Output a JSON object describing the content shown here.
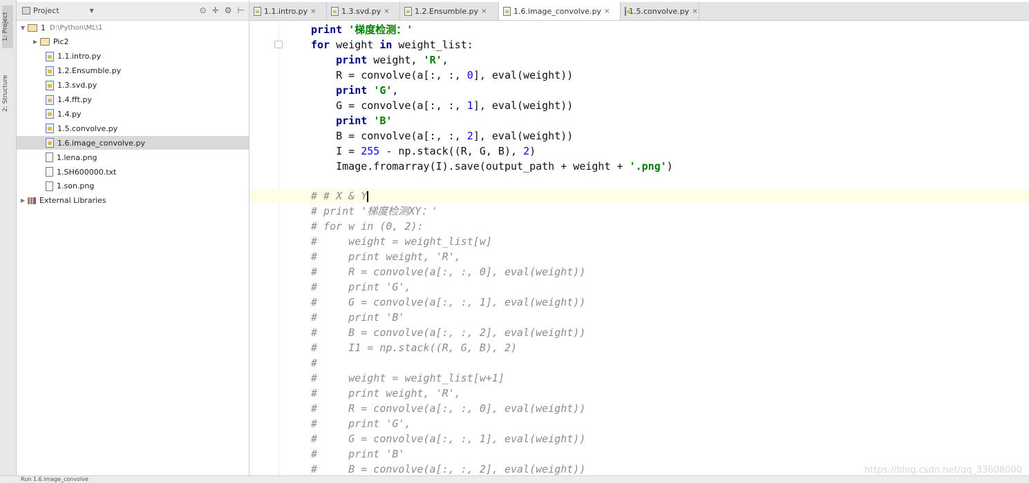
{
  "left_strip": {
    "tab1": "1: Project",
    "tab2": "2: Structure"
  },
  "project_panel": {
    "title": "Project",
    "tree": [
      {
        "label": "1",
        "path": "D:\\Python\\ML\\1",
        "type": "folder",
        "expanded": true,
        "depth": 0
      },
      {
        "label": "Pic2",
        "type": "folder",
        "expanded": false,
        "depth": 1
      },
      {
        "label": "1.1.intro.py",
        "type": "py",
        "depth": 2
      },
      {
        "label": "1.2.Ensumble.py",
        "type": "py",
        "depth": 2
      },
      {
        "label": "1.3.svd.py",
        "type": "py",
        "depth": 2
      },
      {
        "label": "1.4.fft.py",
        "type": "py",
        "depth": 2
      },
      {
        "label": "1.4.py",
        "type": "py",
        "depth": 2
      },
      {
        "label": "1.5.convolve.py",
        "type": "py",
        "depth": 2
      },
      {
        "label": "1.6.image_convolve.py",
        "type": "py",
        "depth": 2,
        "selected": true
      },
      {
        "label": "1.lena.png",
        "type": "img",
        "depth": 2
      },
      {
        "label": "1.SH600000.txt",
        "type": "txt",
        "depth": 2
      },
      {
        "label": "1.son.png",
        "type": "img",
        "depth": 2
      },
      {
        "label": "External Libraries",
        "type": "lib",
        "expanded": false,
        "depth": 0
      }
    ]
  },
  "tabs": [
    {
      "label": "1.1.intro.py",
      "active": false
    },
    {
      "label": "1.3.svd.py",
      "active": false
    },
    {
      "label": "1.2.Ensumble.py",
      "active": false
    },
    {
      "label": "1.6.image_convolve.py",
      "active": true
    },
    {
      "label": "1.5.convolve.py",
      "active": false
    }
  ],
  "close_glyph": "×",
  "code": {
    "lines": [
      "print '梯度检测：'",
      "for weight in weight_list:",
      "    print weight, 'R',",
      "    R = convolve(a[:, :, 0], eval(weight))",
      "    print 'G',",
      "    G = convolve(a[:, :, 1], eval(weight))",
      "    print 'B'",
      "    B = convolve(a[:, :, 2], eval(weight))",
      "    I = 255 - np.stack((R, G, B), 2)",
      "    Image.fromarray(I).save(output_path + weight + '.png')",
      "",
      "# # X & Y",
      "# print '梯度检测XY：'",
      "# for w in (0, 2):",
      "#     weight = weight_list[w]",
      "#     print weight, 'R',",
      "#     R = convolve(a[:, :, 0], eval(weight))",
      "#     print 'G',",
      "#     G = convolve(a[:, :, 1], eval(weight))",
      "#     print 'B'",
      "#     B = convolve(a[:, :, 2], eval(weight))",
      "#     I1 = np.stack((R, G, B), 2)",
      "#",
      "#     weight = weight_list[w+1]",
      "#     print weight, 'R',",
      "#     R = convolve(a[:, :, 0], eval(weight))",
      "#     print 'G',",
      "#     G = convolve(a[:, :, 1], eval(weight))",
      "#     print 'B'",
      "#     B = convolve(a[:, :, 2], eval(weight))"
    ],
    "current_line": 11
  },
  "bottom_bar": {
    "label": "Run  1.6.image_convolve"
  },
  "watermark": "https://blog.csdn.net/qq_33608000"
}
